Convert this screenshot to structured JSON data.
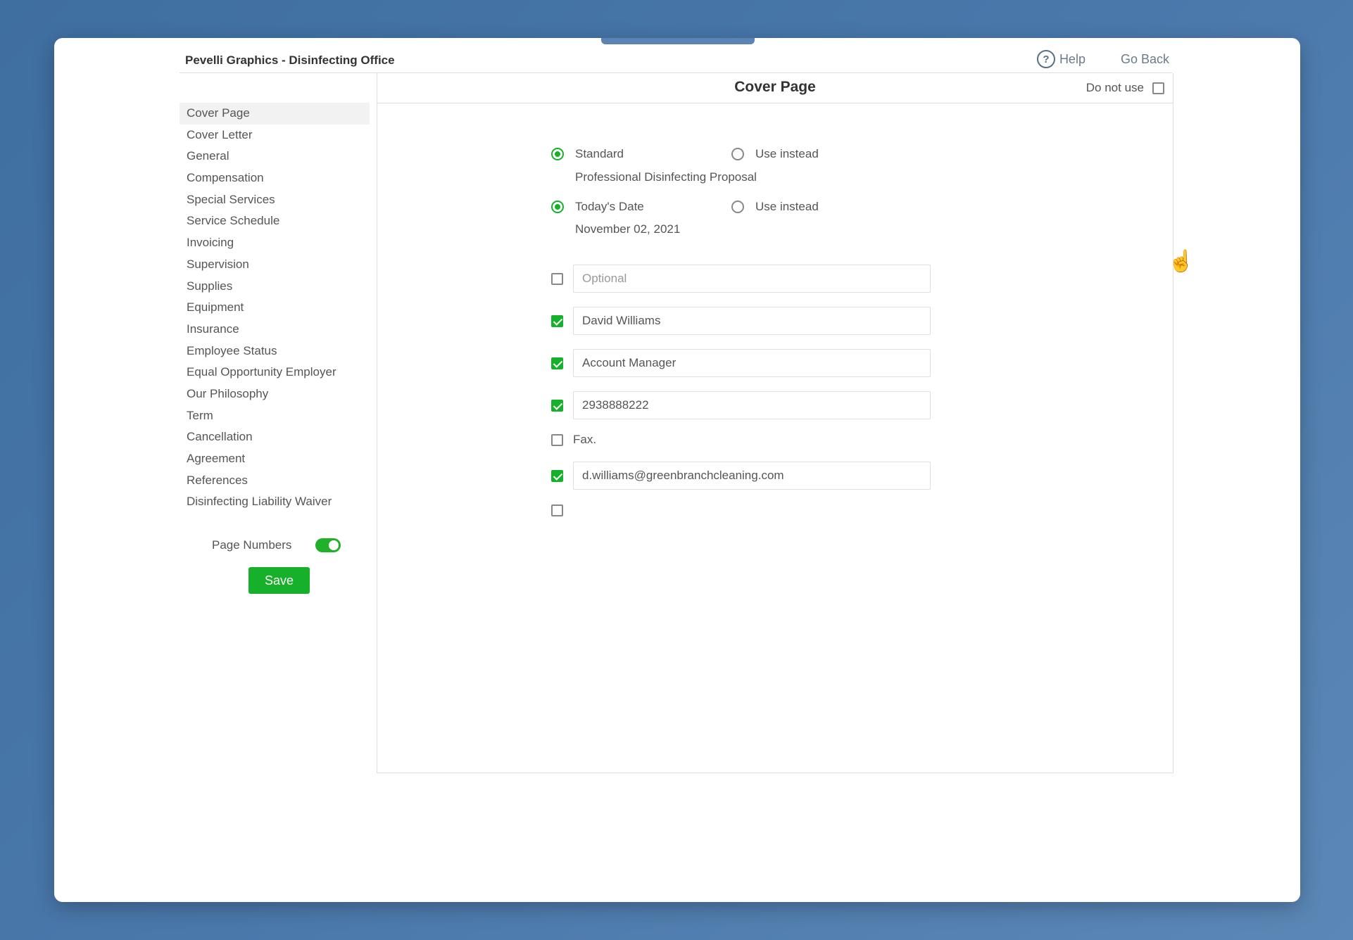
{
  "app": {
    "title": "Pevelli Graphics - Disinfecting Office"
  },
  "header": {
    "help_label": "Help",
    "go_back_label": "Go Back"
  },
  "sidebar": {
    "items": [
      {
        "label": "Cover Page",
        "active": true
      },
      {
        "label": "Cover Letter"
      },
      {
        "label": "General"
      },
      {
        "label": "Compensation"
      },
      {
        "label": "Special Services"
      },
      {
        "label": "Service Schedule"
      },
      {
        "label": "Invoicing"
      },
      {
        "label": "Supervision"
      },
      {
        "label": "Supplies"
      },
      {
        "label": "Equipment"
      },
      {
        "label": "Insurance"
      },
      {
        "label": "Employee Status"
      },
      {
        "label": "Equal Opportunity Employer"
      },
      {
        "label": "Our Philosophy"
      },
      {
        "label": "Term"
      },
      {
        "label": "Cancellation"
      },
      {
        "label": "Agreement"
      },
      {
        "label": "References"
      },
      {
        "label": "Disinfecting Liability Waiver"
      }
    ],
    "page_numbers_label": "Page Numbers",
    "page_numbers_on": true,
    "save_label": "Save"
  },
  "panel": {
    "title": "Cover Page",
    "do_not_use_label": "Do not use",
    "title_option": {
      "standard_label": "Standard",
      "use_instead_label": "Use instead",
      "standard_value": "Professional Disinfecting Proposal"
    },
    "date_option": {
      "today_label": "Today's Date",
      "use_instead_label": "Use instead",
      "date_value": "November 02, 2021"
    },
    "fields": {
      "optional_placeholder": "Optional",
      "name": "David Williams",
      "position": "Account Manager",
      "phone": "2938888222",
      "fax_label": "Fax.",
      "email": "d.williams@greenbranchcleaning.com"
    }
  },
  "colors": {
    "accent": "#17b02a",
    "background": "#4a78ab"
  }
}
